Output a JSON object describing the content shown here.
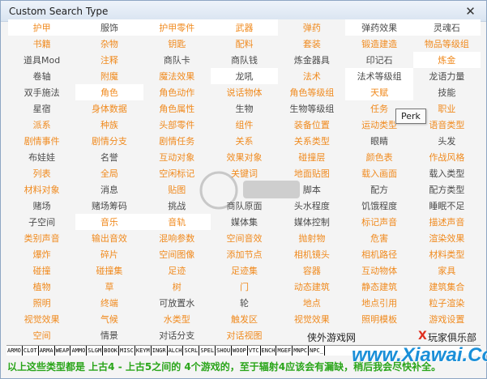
{
  "window": {
    "title": "Custom Search Type",
    "close_glyph": "✕"
  },
  "grid": [
    [
      [
        "护甲",
        "o",
        "w"
      ],
      [
        "服饰",
        "g",
        "w"
      ],
      [
        "护甲零件",
        "o",
        "w"
      ],
      [
        "武器",
        "o",
        "w"
      ],
      [
        "弹药",
        "o",
        "b"
      ],
      [
        "弹药效果",
        "g",
        "w"
      ],
      [
        "灵魂石",
        "g",
        "w"
      ]
    ],
    [
      [
        "书籍",
        "o",
        "b"
      ],
      [
        "杂物",
        "o",
        "b"
      ],
      [
        "钥匙",
        "o",
        "b"
      ],
      [
        "配料",
        "o",
        "b"
      ],
      [
        "套装",
        "o",
        "b"
      ],
      [
        "锻造建造",
        "o",
        "b"
      ],
      [
        "物品等级组",
        "o",
        "b"
      ]
    ],
    [
      [
        "道具Mod",
        "g",
        "b"
      ],
      [
        "注释",
        "o",
        "b"
      ],
      [
        "商队卡",
        "g",
        "b"
      ],
      [
        "商队钱",
        "g",
        "b"
      ],
      [
        "炼金器具",
        "g",
        "b"
      ],
      [
        "印记石",
        "g",
        "b"
      ],
      [
        "炼金",
        "o",
        "w"
      ]
    ],
    [
      [
        "卷轴",
        "g",
        "b"
      ],
      [
        "附魔",
        "o",
        "b"
      ],
      [
        "魔法效果",
        "o",
        "b"
      ],
      [
        "龙吼",
        "g",
        "w"
      ],
      [
        "法术",
        "o",
        "b"
      ],
      [
        "法术等级组",
        "g",
        "w"
      ],
      [
        "龙语力量",
        "g",
        "b"
      ]
    ],
    [
      [
        "双手施法",
        "g",
        "b"
      ],
      [
        "角色",
        "o",
        "w"
      ],
      [
        "角色动作",
        "o",
        "b"
      ],
      [
        "说话物体",
        "o",
        "b"
      ],
      [
        "角色等级组",
        "o",
        "b"
      ],
      [
        "天赋",
        "o",
        "w"
      ],
      [
        "技能",
        "g",
        "b"
      ]
    ],
    [
      [
        "星宿",
        "g",
        "b"
      ],
      [
        "身体数据",
        "o",
        "b"
      ],
      [
        "角色属性",
        "o",
        "b"
      ],
      [
        "生物",
        "g",
        "b"
      ],
      [
        "生物等级组",
        "g",
        "b"
      ],
      [
        "任务",
        "o",
        "b"
      ],
      [
        "职业",
        "o",
        "b"
      ]
    ],
    [
      [
        "派系",
        "o",
        "b"
      ],
      [
        "种族",
        "o",
        "b"
      ],
      [
        "头部零件",
        "o",
        "b"
      ],
      [
        "组件",
        "o",
        "b"
      ],
      [
        "装备位置",
        "o",
        "b"
      ],
      [
        "运动类型",
        "o",
        "b"
      ],
      [
        "语音类型",
        "o",
        "b"
      ]
    ],
    [
      [
        "剧情事件",
        "o",
        "b"
      ],
      [
        "剧情分支",
        "o",
        "b"
      ],
      [
        "剧情任务",
        "o",
        "b"
      ],
      [
        "关系",
        "o",
        "b"
      ],
      [
        "关系类型",
        "o",
        "b"
      ],
      [
        "眼睛",
        "g",
        "b"
      ],
      [
        "头发",
        "g",
        "b"
      ]
    ],
    [
      [
        "布娃娃",
        "g",
        "b"
      ],
      [
        "名誉",
        "g",
        "b"
      ],
      [
        "互动对象",
        "o",
        "b"
      ],
      [
        "效果对象",
        "o",
        "b"
      ],
      [
        "碰撞层",
        "o",
        "b"
      ],
      [
        "颜色表",
        "o",
        "b"
      ],
      [
        "作战风格",
        "o",
        "b"
      ]
    ],
    [
      [
        "列表",
        "o",
        "b"
      ],
      [
        "全局",
        "o",
        "b"
      ],
      [
        "空闲标记",
        "o",
        "b"
      ],
      [
        "关键词",
        "o",
        "b"
      ],
      [
        "地面贴图",
        "o",
        "b"
      ],
      [
        "载入画面",
        "o",
        "b"
      ],
      [
        "载入类型",
        "g",
        "b"
      ]
    ],
    [
      [
        "材料对象",
        "o",
        "b"
      ],
      [
        "消息",
        "g",
        "b"
      ],
      [
        "贴图",
        "o",
        "b"
      ],
      [
        "",
        "g",
        "b"
      ],
      [
        "脚本",
        "g",
        "b"
      ],
      [
        "配方",
        "g",
        "b"
      ],
      [
        "配方类型",
        "g",
        "b"
      ]
    ],
    [
      [
        "赌场",
        "g",
        "b"
      ],
      [
        "赌场筹码",
        "g",
        "b"
      ],
      [
        "挑战",
        "g",
        "b"
      ],
      [
        "商队原面",
        "g",
        "b"
      ],
      [
        "头水程度",
        "g",
        "b"
      ],
      [
        "饥饿程度",
        "g",
        "b"
      ],
      [
        "睡眠不足",
        "g",
        "b"
      ]
    ],
    [
      [
        "子空间",
        "g",
        "b"
      ],
      [
        "音乐",
        "o",
        "w"
      ],
      [
        "音轨",
        "o",
        "w"
      ],
      [
        "媒体集",
        "g",
        "b"
      ],
      [
        "媒体控制",
        "g",
        "b"
      ],
      [
        "标记声音",
        "o",
        "b"
      ],
      [
        "描述声音",
        "o",
        "b"
      ]
    ],
    [
      [
        "类别声音",
        "o",
        "b"
      ],
      [
        "输出音效",
        "o",
        "b"
      ],
      [
        "混响参数",
        "o",
        "b"
      ],
      [
        "空间音效",
        "o",
        "b"
      ],
      [
        "抛射物",
        "o",
        "b"
      ],
      [
        "危害",
        "o",
        "b"
      ],
      [
        "渲染效果",
        "o",
        "b"
      ]
    ],
    [
      [
        "爆炸",
        "o",
        "b"
      ],
      [
        "碎片",
        "o",
        "b"
      ],
      [
        "空间图像",
        "o",
        "b"
      ],
      [
        "添加节点",
        "o",
        "b"
      ],
      [
        "相机镜头",
        "o",
        "b"
      ],
      [
        "相机路径",
        "o",
        "b"
      ],
      [
        "材料类型",
        "o",
        "b"
      ]
    ],
    [
      [
        "碰撞",
        "o",
        "b"
      ],
      [
        "碰撞集",
        "o",
        "b"
      ],
      [
        "足迹",
        "o",
        "b"
      ],
      [
        "足迹集",
        "o",
        "b"
      ],
      [
        "容器",
        "o",
        "b"
      ],
      [
        "互动物体",
        "o",
        "b"
      ],
      [
        "家具",
        "o",
        "b"
      ]
    ],
    [
      [
        "植物",
        "o",
        "b"
      ],
      [
        "草",
        "o",
        "b"
      ],
      [
        "树",
        "o",
        "b"
      ],
      [
        "门",
        "o",
        "b"
      ],
      [
        "动态建筑",
        "o",
        "b"
      ],
      [
        "静态建筑",
        "o",
        "b"
      ],
      [
        "建筑集合",
        "o",
        "b"
      ]
    ],
    [
      [
        "照明",
        "o",
        "b"
      ],
      [
        "终端",
        "o",
        "b"
      ],
      [
        "可放置水",
        "g",
        "b"
      ],
      [
        "轮",
        "g",
        "b"
      ],
      [
        "地点",
        "o",
        "b"
      ],
      [
        "地点引用",
        "o",
        "b"
      ],
      [
        "粒子渲染",
        "o",
        "b"
      ]
    ],
    [
      [
        "视觉效果",
        "o",
        "b"
      ],
      [
        "气候",
        "o",
        "b"
      ],
      [
        "水类型",
        "o",
        "b"
      ],
      [
        "触发区",
        "o",
        "b"
      ],
      [
        "视觉效果",
        "o",
        "b"
      ],
      [
        "照明模板",
        "o",
        "b"
      ],
      [
        "游戏设置",
        "o",
        "b"
      ]
    ],
    [
      [
        "空间",
        "o",
        "b"
      ],
      [
        "情景",
        "g",
        "b"
      ],
      [
        "对话分支",
        "g",
        "b"
      ],
      [
        "对话视图",
        "o",
        "b"
      ],
      [
        "",
        "g",
        "b"
      ],
      [
        "",
        "g",
        "b"
      ],
      [
        "",
        "g",
        "b"
      ]
    ]
  ],
  "tooltip": "Perk",
  "tag_bar": [
    "ARMO",
    "CLOT",
    "ARMA",
    "WEAP",
    "AMMO",
    "SLGM",
    "BOOK",
    "MISC",
    "KEYM",
    "INGR",
    "ALCH",
    "SCRL",
    "SPEL",
    "SHOU",
    "WOOP",
    "VTC",
    "ENCH",
    "MGEF",
    "MNPC",
    "NPC_"
  ],
  "note": "以上这些类型都是 上古4 - 上古5之间的 4个游戏的，至于辐射4应该会有漏缺，稍后我会尽快补全。",
  "watermarks": {
    "left": "侠外游戏网",
    "right": "玩家俱乐部",
    "big": "www.Xiawai.Com",
    "x": "X"
  },
  "colors": {
    "orange": "#f08a1e",
    "gray": "#4a4a4a",
    "green": "#2aa51a"
  }
}
